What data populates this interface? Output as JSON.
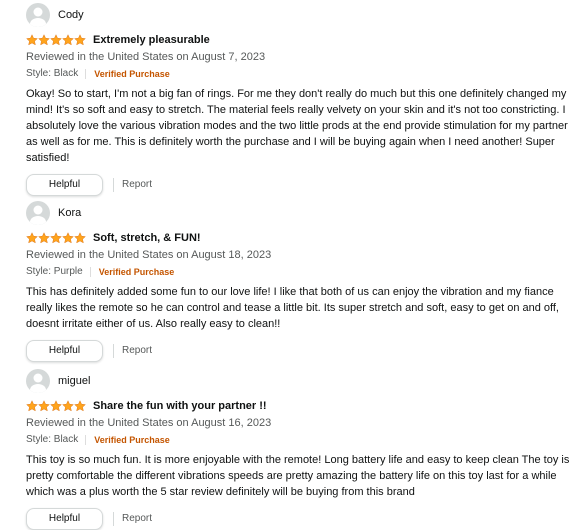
{
  "colors": {
    "star": "#ffa41c",
    "verified": "#c45500",
    "secondary_text": "#565959",
    "primary_text": "#0f1111",
    "avatar_bg": "#d5d9d9"
  },
  "reviews": [
    {
      "username": "Cody",
      "rating": 5,
      "rating_max": 5,
      "title": "Extremely pleasurable",
      "date_line": "Reviewed in the United States on August 7, 2023",
      "style": "Style: Black",
      "verified": "Verified Purchase",
      "body": "Okay! So to start, I'm not a big fan of rings. For me they don't really do much but this one definitely changed my mind! It's so soft and easy to stretch. The material feels really velvety on your skin and it's not too constricting. I absolutely love the various vibration modes and the two little prods at the end provide stimulation for my partner as well as for me. This is definitely worth the purchase and I will be buying again when I need another! Super satisfied!",
      "helpful_label": "Helpful",
      "report_label": "Report"
    },
    {
      "username": "Kora",
      "rating": 5,
      "rating_max": 5,
      "title": "Soft, stretch, & FUN!",
      "date_line": "Reviewed in the United States on August 18, 2023",
      "style": "Style: Purple",
      "verified": "Verified Purchase",
      "body": "This has definitely added some fun to our love life! I like that both of us can enjoy the vibration and my fiance really likes the remote so he can control and tease a little bit. Its super stretch and soft, easy to get on and off, doesnt irritate either of us. Also really easy to clean!!",
      "helpful_label": "Helpful",
      "report_label": "Report"
    },
    {
      "username": "miguel",
      "rating": 5,
      "rating_max": 5,
      "title": "Share the fun with your partner !!",
      "date_line": "Reviewed in the United States on August 16, 2023",
      "style": "Style: Black",
      "verified": "Verified Purchase",
      "body": "This toy is so much fun. It is more enjoyable with the remote! Long battery life and easy to keep clean The toy is pretty comfortable the different vibrations speeds are pretty amazing the battery life on this toy last for a while which was a plus worth the 5 star review definitely will be buying from this brand",
      "helpful_label": "Helpful",
      "report_label": "Report"
    }
  ]
}
